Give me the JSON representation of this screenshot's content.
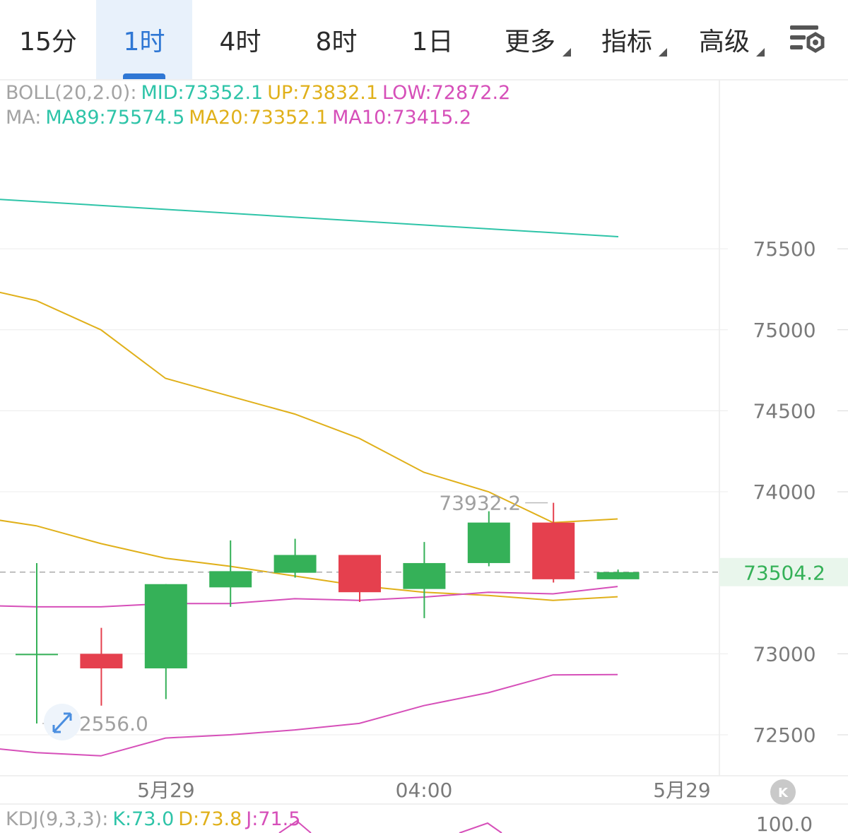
{
  "tabs": [
    {
      "label": "15分",
      "active": false
    },
    {
      "label": "1时",
      "active": true
    },
    {
      "label": "4时",
      "active": false
    },
    {
      "label": "8时",
      "active": false
    },
    {
      "label": "1日",
      "active": false
    },
    {
      "label": "更多",
      "active": false,
      "dropdown": true
    },
    {
      "label": "指标",
      "active": false,
      "dropdown": true
    },
    {
      "label": "高级",
      "active": false,
      "dropdown": true
    }
  ],
  "settings_icon": "chart-settings-icon",
  "boll": {
    "label": "BOLL(20,2.0):",
    "mid": "MID:73352.1",
    "up": "UP:73832.1",
    "low": "LOW:72872.2"
  },
  "ma": {
    "label": "MA:",
    "ma89": "MA89:75574.5",
    "ma20": "MA20:73352.1",
    "ma10": "MA10:73415.2"
  },
  "kdj": {
    "label": "KDJ(9,3,3):",
    "k": "K:73.0",
    "d": "D:73.8",
    "j": "J:71.5"
  },
  "colors": {
    "up": "#35b158",
    "down": "#e5404e",
    "ma89": "#2ec4a8",
    "ma20": "#e0b01a",
    "ma10": "#d64fb9",
    "accent": "#2f77d4",
    "grid": "#ececec",
    "axis_text": "#7a7a7a"
  },
  "chart_data": {
    "type": "candlestick",
    "y_ticks": [
      75500,
      75000,
      74500,
      74000,
      73000,
      72500
    ],
    "x_tick_labels": [
      "5月29",
      "04:00",
      "5月29"
    ],
    "last_price": "73504.2",
    "max_label": "73932.2",
    "min_label": "72556.0",
    "kdj_axis_label": "100.0",
    "candles": [
      {
        "open": 73000,
        "close": 73000,
        "high": 73560,
        "low": 72570
      },
      {
        "open": 73000,
        "close": 72910,
        "high": 73160,
        "low": 72680
      },
      {
        "open": 72910,
        "close": 73430,
        "high": 73430,
        "low": 72720
      },
      {
        "open": 73410,
        "close": 73510,
        "high": 73700,
        "low": 73290
      },
      {
        "open": 73500,
        "close": 73610,
        "high": 73710,
        "low": 73470
      },
      {
        "open": 73610,
        "close": 73380,
        "high": 73610,
        "low": 73320
      },
      {
        "open": 73400,
        "close": 73560,
        "high": 73690,
        "low": 73220
      },
      {
        "open": 73560,
        "close": 73810,
        "high": 73880,
        "low": 73540
      },
      {
        "open": 73810,
        "close": 73460,
        "high": 73932.2,
        "low": 73440
      },
      {
        "open": 73460,
        "close": 73504.2,
        "high": 73520,
        "low": 73460
      }
    ],
    "ma89": [
      75805,
      75574.5
    ],
    "boll_up": [
      75270,
      75180,
      75000,
      74700,
      74590,
      74480,
      74330,
      74120,
      74000,
      73810,
      73832.1
    ],
    "boll_mid": [
      73850,
      73790,
      73680,
      73590,
      73540,
      73480,
      73420,
      73380,
      73360,
      73330,
      73352.1
    ],
    "boll_low": [
      72430,
      72390,
      72370,
      72480,
      72500,
      72530,
      72570,
      72680,
      72760,
      72870,
      72872.2
    ],
    "ma10": [
      73300,
      73290,
      73290,
      73310,
      73310,
      73340,
      73330,
      73350,
      73380,
      73370,
      73415.2
    ]
  }
}
